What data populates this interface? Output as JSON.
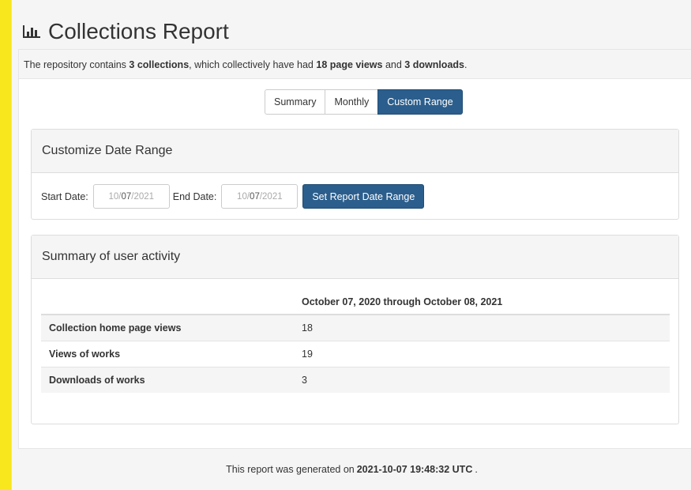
{
  "header": {
    "title": "Collections Report",
    "icon": "bar-chart-icon"
  },
  "summary": {
    "prefix": "The repository contains",
    "collections": "3 collections",
    "middle": ", which collectively have had",
    "page_views": "18 page views",
    "and": "and",
    "downloads": "3 downloads",
    "suffix": "."
  },
  "tabs": [
    {
      "label": "Summary",
      "active": false
    },
    {
      "label": "Monthly",
      "active": false
    },
    {
      "label": "Custom Range",
      "active": true
    }
  ],
  "date_range": {
    "heading": "Customize Date Range",
    "start_label": "Start Date:",
    "start_month": "10/",
    "start_day": "07",
    "start_year": "/2021",
    "end_label": "End Date:",
    "end_month": "10/",
    "end_day": "07",
    "end_year": "/2021",
    "button": "Set Report Date Range"
  },
  "activity": {
    "heading": "Summary of user activity",
    "column_header": "October 07, 2020 through October 08, 2021",
    "rows": [
      {
        "label": "Collection home page views",
        "value": "18"
      },
      {
        "label": "Views of works",
        "value": "19"
      },
      {
        "label": "Downloads of works",
        "value": "3"
      }
    ]
  },
  "footer": {
    "prefix": "This report was generated on",
    "timestamp": "2021-10-07 19:48:32 UTC",
    "suffix": "."
  },
  "colors": {
    "primary": "#2b5e8c",
    "highlight": "#f8e71c"
  }
}
